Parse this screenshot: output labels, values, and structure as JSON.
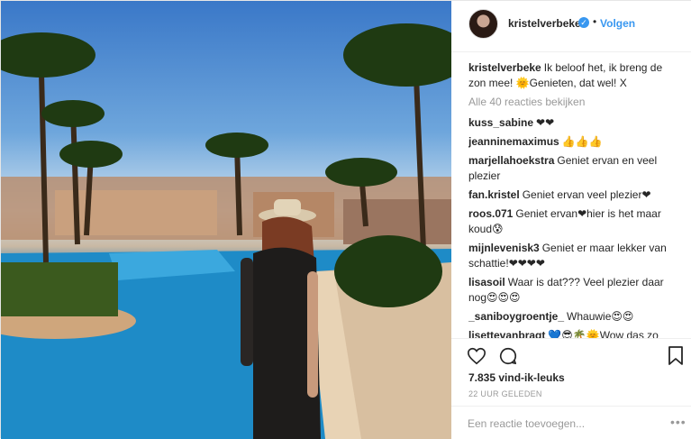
{
  "author": {
    "username": "kristelverbeke",
    "follow_label": "Volgen",
    "separator": "•"
  },
  "caption": {
    "username": "kristelverbeke",
    "text": "Ik beloof het, ik breng de zon mee! 🌞Genieten, dat wel! X"
  },
  "view_all": "Alle 40 reacties bekijken",
  "comments": [
    {
      "user": "kuss_sabine",
      "text": "❤❤"
    },
    {
      "user": "jeanninemaximus",
      "text": "👍👍👍"
    },
    {
      "user": "marjellahoekstra",
      "text": "Geniet ervan en veel plezier"
    },
    {
      "user": "fan.kristel",
      "text": "Geniet ervan veel plezier❤"
    },
    {
      "user": "roos.071",
      "text": "Geniet ervan❤hier is het maar koud😰"
    },
    {
      "user": "mijnlevenisk3",
      "text": "Geniet er maar lekker van schattie!❤❤❤❤"
    },
    {
      "user": "lisasoil",
      "text": "Waar is dat??? Veel plezier daar nog😍😍😍"
    },
    {
      "user": "_saniboygroentje_",
      "text": "Whauwie😍😍"
    },
    {
      "user": "lisettevanbragt",
      "text": "💙😎🌴🌞Wow das zo mooi!!😍🌴💛🔥💙"
    }
  ],
  "likes": "7.835 vind-ik-leuks",
  "timestamp": "22 UUR GELEDEN",
  "add_comment_placeholder": "Een reactie toevoegen...",
  "more_label": "•••",
  "colors": {
    "link": "#3897f0",
    "muted": "#999999",
    "text": "#262626"
  },
  "icons": [
    "verified-badge-icon",
    "heart-icon",
    "comment-icon",
    "bookmark-icon",
    "more-options-icon"
  ]
}
